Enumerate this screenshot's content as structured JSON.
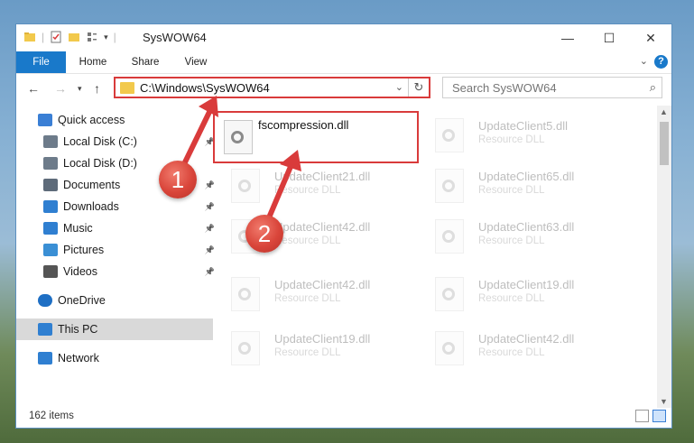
{
  "window": {
    "title": "SysWOW64",
    "controls": {
      "minimize": "—",
      "maximize": "☐",
      "close": "✕"
    }
  },
  "ribbon": {
    "tabs": [
      "File",
      "Home",
      "Share",
      "View"
    ],
    "help": "?"
  },
  "navigation": {
    "address": "C:\\Windows\\SysWOW64",
    "search_placeholder": "Search SysWOW64"
  },
  "sidebar": {
    "items": [
      {
        "label": "Quick access",
        "icon": "star-icon",
        "pinned": false
      },
      {
        "label": "Local Disk (C:)",
        "icon": "drive-icon",
        "pinned": true
      },
      {
        "label": "Local Disk (D:)",
        "icon": "drive-icon",
        "pinned": false
      },
      {
        "label": "Documents",
        "icon": "document-icon",
        "pinned": true
      },
      {
        "label": "Downloads",
        "icon": "download-icon",
        "pinned": true
      },
      {
        "label": "Music",
        "icon": "music-icon",
        "pinned": true
      },
      {
        "label": "Pictures",
        "icon": "picture-icon",
        "pinned": true
      },
      {
        "label": "Videos",
        "icon": "video-icon",
        "pinned": true
      },
      {
        "label": "OneDrive",
        "icon": "cloud-icon",
        "pinned": false
      },
      {
        "label": "This PC",
        "icon": "computer-icon",
        "pinned": false,
        "selected": true
      },
      {
        "label": "Network",
        "icon": "network-icon",
        "pinned": false
      }
    ]
  },
  "files": {
    "highlighted": {
      "name": "fscompression.dll"
    },
    "others": [
      {
        "name": "UpdateClient5.dll",
        "type": "Resource DLL"
      },
      {
        "name": "UpdateClient21.dll",
        "type": "Resource DLL"
      },
      {
        "name": "UpdateClient65.dll",
        "type": "Resource DLL"
      },
      {
        "name": "UpdateClient42.dll",
        "type": "Resource DLL"
      },
      {
        "name": "UpdateClient63.dll",
        "type": "Resource DLL"
      },
      {
        "name": "UpdateClient42.dll",
        "type": "Resource DLL"
      },
      {
        "name": "UpdateClient19.dll",
        "type": "Resource DLL"
      },
      {
        "name": "UpdateClient19.dll",
        "type": "Resource DLL"
      },
      {
        "name": "UpdateClient42.dll",
        "type": "Resource DLL"
      }
    ]
  },
  "status": {
    "item_count": "162 items"
  },
  "annotations": {
    "step1": "1",
    "step2": "2"
  },
  "colors": {
    "accent": "#1979ca",
    "highlight": "#d93b3b"
  }
}
